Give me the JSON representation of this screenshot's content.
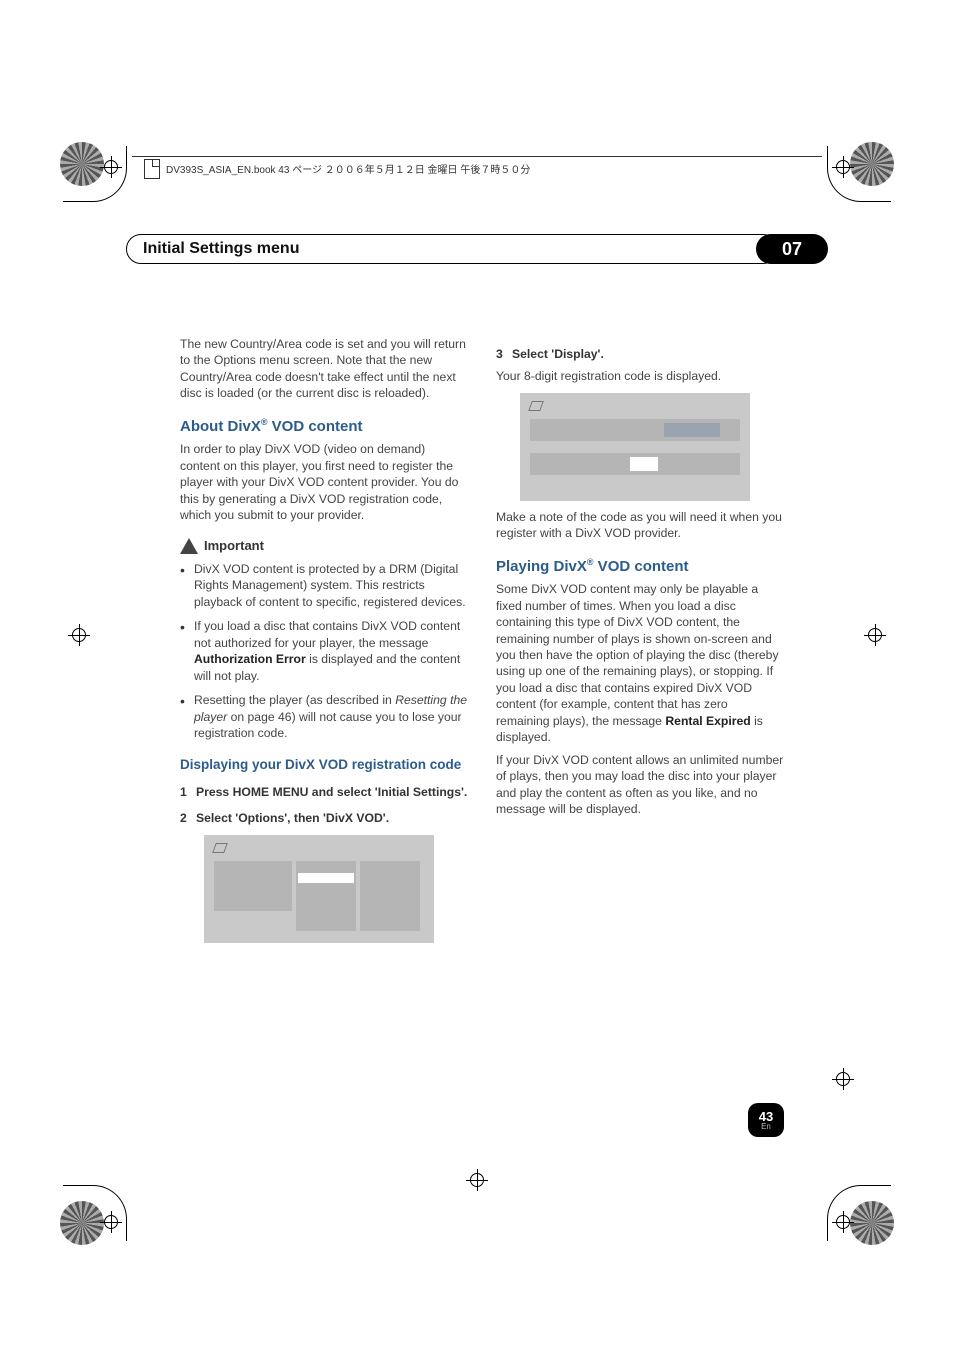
{
  "book_header": "DV393S_ASIA_EN.book 43 ページ ２００６年５月１２日 金曜日 午後７時５０分",
  "chapter": {
    "title": "Initial Settings menu",
    "number": "07"
  },
  "left": {
    "intro": "The new Country/Area code is set and you will return to the Options menu screen. Note that the new Country/Area code doesn't take effect until the next disc is loaded (or the current disc is reloaded).",
    "h_about_pre": "About DivX",
    "h_about_suf": " VOD content",
    "about_p": "In order to play DivX VOD (video on demand) content on this player, you first need to register the player with your DivX VOD content provider. You do this by generating a DivX VOD registration code, which you submit to your provider.",
    "important_label": "Important",
    "bullets": [
      "DivX VOD content is protected by a DRM (Digital Rights Management) system. This restricts playback of content to specific, registered devices.",
      "If you load a disc that contains DivX VOD content not authorized for your player, the message <b>Authorization Error</b> is displayed and the content will not play.",
      "Resetting the player (as described in <i>Resetting the player</i> on page 46) will not cause you to lose your registration code."
    ],
    "h_display": "Displaying your DivX VOD registration code",
    "step1": "Press HOME MENU and select 'Initial Settings'.",
    "step2": "Select 'Options', then 'DivX VOD'."
  },
  "right": {
    "step3": "Select 'Display'.",
    "step3_sub": "Your 8-digit registration code is displayed.",
    "note": "Make a note of the code as you will need it when you register with a DivX VOD provider.",
    "h_play_pre": "Playing DivX",
    "h_play_suf": " VOD content",
    "play_p1": "Some DivX VOD content may only be playable a fixed number of times. When you load a disc containing this type of DivX VOD content, the remaining number of plays is shown on-screen and you then have the option of playing the disc (thereby using up one of the remaining plays), or stopping. If you load a disc that contains expired DivX VOD content (for example, content that has zero remaining plays), the message <b>Rental Expired</b> is displayed.",
    "play_p2": "If your DivX VOD content allows an unlimited number of plays, then you may load the disc into your player and play the content as often as you like, and no message will be displayed."
  },
  "page": {
    "num": "43",
    "lang": "En"
  }
}
